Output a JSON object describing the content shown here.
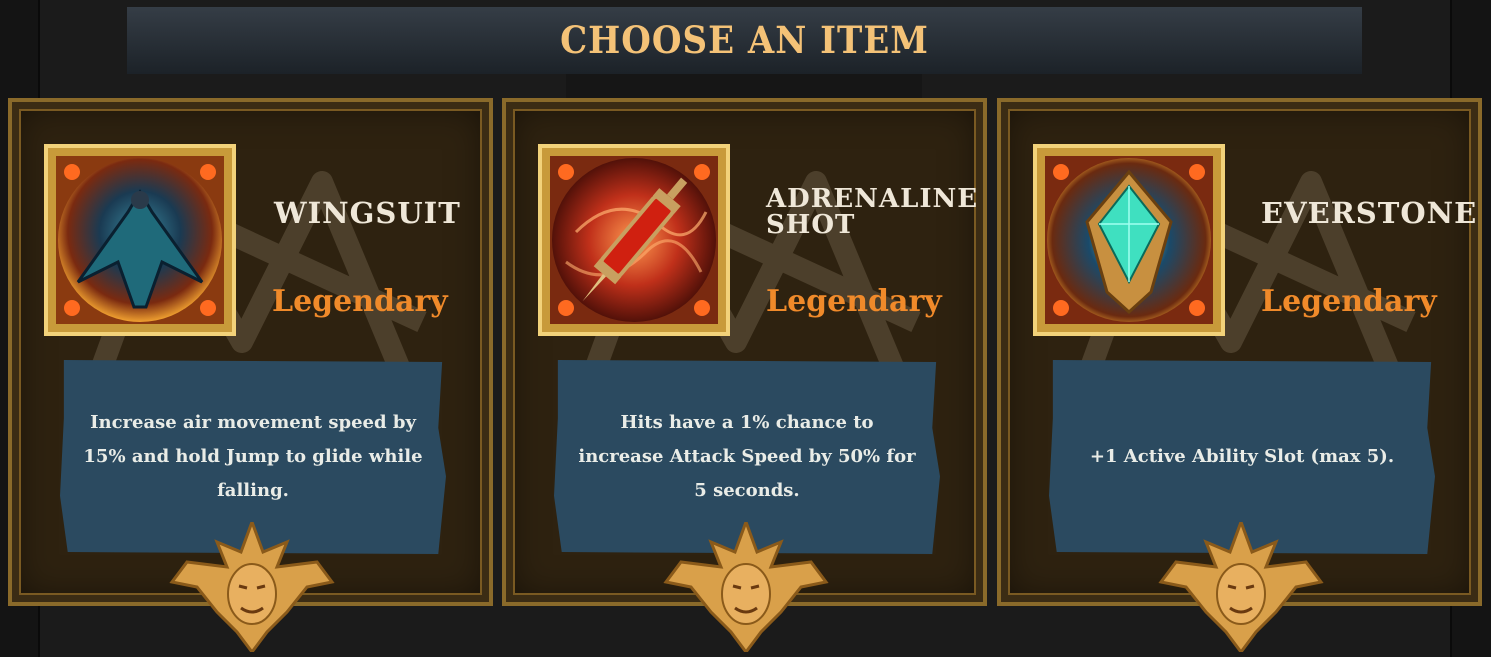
{
  "header": {
    "title": "CHOOSE AN ITEM"
  },
  "items": [
    {
      "name": "WINGSUIT",
      "rarity": "Legendary",
      "description": "Increase air movement speed by 15% and hold Jump to glide while falling.",
      "icon": "wingsuit-icon",
      "colors": {
        "core": "#1f6a7a",
        "glow": "#f0a030"
      }
    },
    {
      "name": "ADRENALINE SHOT",
      "rarity": "Legendary",
      "description": "Hits have a 1% chance to increase Attack Speed by 50% for 5 seconds.",
      "icon": "adrenaline-shot-icon",
      "colors": {
        "core": "#c0301a",
        "glow": "#ff7a30"
      }
    },
    {
      "name": "EVERSTONE",
      "rarity": "Legendary",
      "description": "+1 Active Ability Slot (max 5).",
      "icon": "everstone-icon",
      "colors": {
        "core": "#1fb0a0",
        "glow": "#3fe0c0"
      }
    }
  ],
  "theme": {
    "title_color": "#f4c277",
    "rarity_color": "#f08a2a",
    "card_bg": "#2e2210",
    "desc_bg": "#2b4a60"
  }
}
